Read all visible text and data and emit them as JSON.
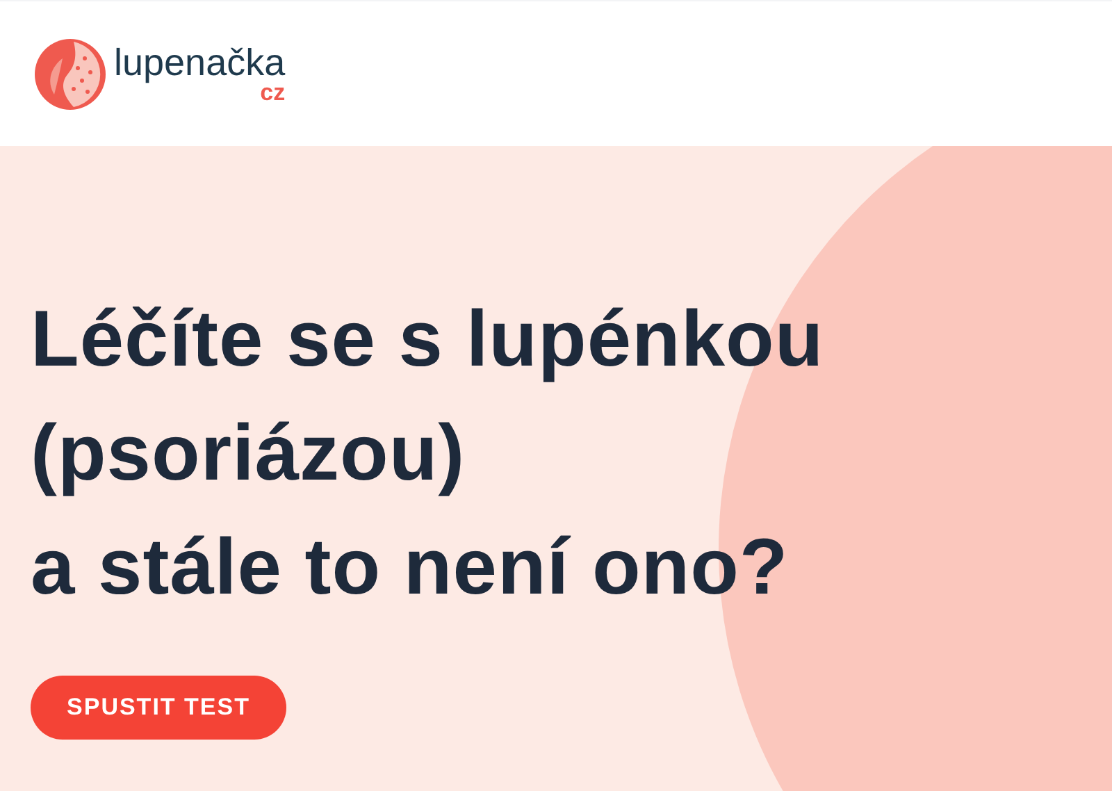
{
  "header": {
    "logo": {
      "name": "lupenačka",
      "suffix": "cz"
    }
  },
  "hero": {
    "headline": [
      "Léčíte se s lupénkou",
      "(psoriázou)",
      "a stále to není ono?"
    ],
    "button": "SPUSTIT TEST"
  }
}
